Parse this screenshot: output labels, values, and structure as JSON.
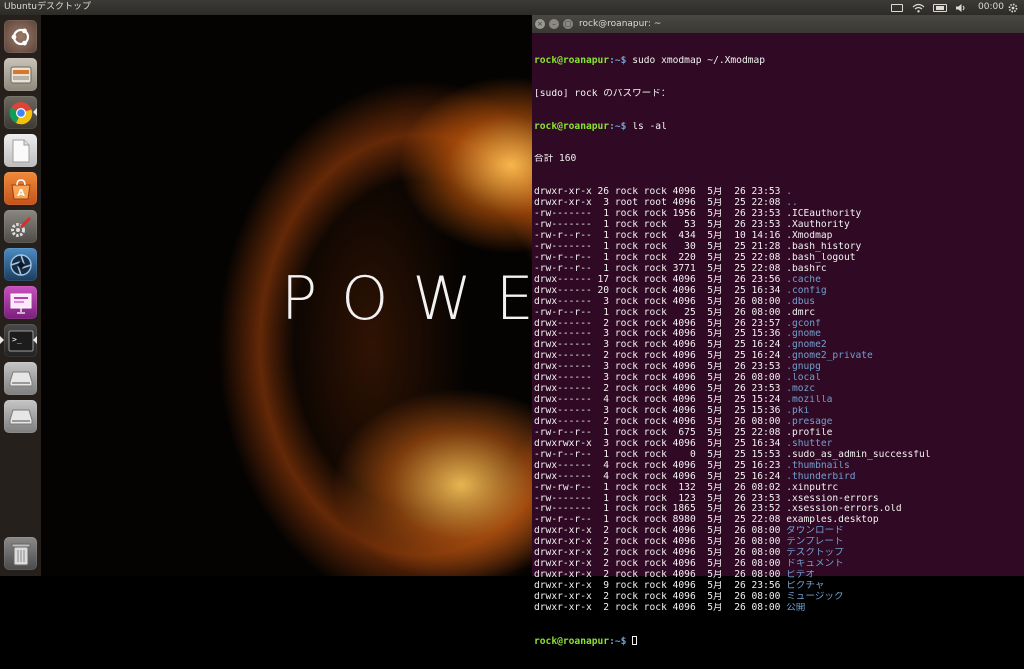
{
  "top_panel": {
    "title": "Ubuntuデスクトップ",
    "clock": "00:00",
    "indicators": [
      "keyboard-icon",
      "wifi-icon",
      "battery-icon",
      "volume-icon",
      "gear-icon"
    ]
  },
  "launcher": {
    "items": [
      {
        "name": "dash-home",
        "icon": "ubuntu-logo-icon"
      },
      {
        "name": "files",
        "icon": "file-manager-icon"
      },
      {
        "name": "chrome",
        "icon": "chrome-icon"
      },
      {
        "name": "document",
        "icon": "document-icon"
      },
      {
        "name": "software-center",
        "icon": "software-center-icon"
      },
      {
        "name": "system-settings",
        "icon": "settings-icon"
      },
      {
        "name": "shutter",
        "icon": "shutter-icon"
      },
      {
        "name": "presentation",
        "icon": "presentation-icon"
      },
      {
        "name": "terminal",
        "icon": "terminal-icon"
      },
      {
        "name": "drive-1",
        "icon": "drive-icon"
      },
      {
        "name": "drive-2",
        "icon": "drive-icon"
      },
      {
        "name": "trash",
        "icon": "trash-icon"
      }
    ],
    "app_letter": "A",
    "terminal_glyph": ">_"
  },
  "wallpaper": {
    "text": "POWER"
  },
  "terminal": {
    "title": "rock@roanapur: ~",
    "prompt_user": "rock@roanapur",
    "prompt_path": ":~$ ",
    "command1": "sudo xmodmap ~/.Xmodmap",
    "sudo_prompt": "[sudo] rock のパスワード：",
    "command2": "ls -al",
    "total": "合計 160",
    "entries": [
      {
        "meta": "drwxr-xr-x 26 rock rock 4096  5月  26 23:53 ",
        "name": ".",
        "dir": true
      },
      {
        "meta": "drwxr-xr-x  3 root root 4096  5月  25 22:08 ",
        "name": "..",
        "dir": true
      },
      {
        "meta": "-rw-------  1 rock rock 1956  5月  26 23:53 ",
        "name": ".ICEauthority",
        "dir": false
      },
      {
        "meta": "-rw-------  1 rock rock   53  5月  26 23:53 ",
        "name": ".Xauthority",
        "dir": false
      },
      {
        "meta": "-rw-r--r--  1 rock rock  434  5月  10 14:16 ",
        "name": ".Xmodmap",
        "dir": false
      },
      {
        "meta": "-rw-------  1 rock rock   30  5月  25 21:28 ",
        "name": ".bash_history",
        "dir": false
      },
      {
        "meta": "-rw-r--r--  1 rock rock  220  5月  25 22:08 ",
        "name": ".bash_logout",
        "dir": false
      },
      {
        "meta": "-rw-r--r--  1 rock rock 3771  5月  25 22:08 ",
        "name": ".bashrc",
        "dir": false
      },
      {
        "meta": "drwx------ 17 rock rock 4096  5月  26 23:56 ",
        "name": ".cache",
        "dir": true
      },
      {
        "meta": "drwx------ 20 rock rock 4096  5月  25 16:34 ",
        "name": ".config",
        "dir": true
      },
      {
        "meta": "drwx------  3 rock rock 4096  5月  26 08:00 ",
        "name": ".dbus",
        "dir": true
      },
      {
        "meta": "-rw-r--r--  1 rock rock   25  5月  26 08:00 ",
        "name": ".dmrc",
        "dir": false
      },
      {
        "meta": "drwx------  2 rock rock 4096  5月  26 23:57 ",
        "name": ".gconf",
        "dir": true
      },
      {
        "meta": "drwx------  3 rock rock 4096  5月  25 15:36 ",
        "name": ".gnome",
        "dir": true
      },
      {
        "meta": "drwx------  3 rock rock 4096  5月  25 16:24 ",
        "name": ".gnome2",
        "dir": true
      },
      {
        "meta": "drwx------  2 rock rock 4096  5月  25 16:24 ",
        "name": ".gnome2_private",
        "dir": true
      },
      {
        "meta": "drwx------  3 rock rock 4096  5月  26 23:53 ",
        "name": ".gnupg",
        "dir": true
      },
      {
        "meta": "drwx------  3 rock rock 4096  5月  26 08:00 ",
        "name": ".local",
        "dir": true
      },
      {
        "meta": "drwx------  2 rock rock 4096  5月  26 23:53 ",
        "name": ".mozc",
        "dir": true
      },
      {
        "meta": "drwx------  4 rock rock 4096  5月  25 15:24 ",
        "name": ".mozilla",
        "dir": true
      },
      {
        "meta": "drwx------  3 rock rock 4096  5月  25 15:36 ",
        "name": ".pki",
        "dir": true
      },
      {
        "meta": "drwx------  2 rock rock 4096  5月  26 08:00 ",
        "name": ".presage",
        "dir": true
      },
      {
        "meta": "-rw-r--r--  1 rock rock  675  5月  25 22:08 ",
        "name": ".profile",
        "dir": false
      },
      {
        "meta": "drwxrwxr-x  3 rock rock 4096  5月  25 16:34 ",
        "name": ".shutter",
        "dir": true
      },
      {
        "meta": "-rw-r--r--  1 rock rock    0  5月  25 15:53 ",
        "name": ".sudo_as_admin_successful",
        "dir": false
      },
      {
        "meta": "drwx------  4 rock rock 4096  5月  25 16:23 ",
        "name": ".thumbnails",
        "dir": true
      },
      {
        "meta": "drwx------  4 rock rock 4096  5月  25 16:24 ",
        "name": ".thunderbird",
        "dir": true
      },
      {
        "meta": "-rw-rw-r--  1 rock rock  132  5月  26 08:02 ",
        "name": ".xinputrc",
        "dir": false
      },
      {
        "meta": "-rw-------  1 rock rock  123  5月  26 23:53 ",
        "name": ".xsession-errors",
        "dir": false
      },
      {
        "meta": "-rw-------  1 rock rock 1865  5月  26 23:52 ",
        "name": ".xsession-errors.old",
        "dir": false
      },
      {
        "meta": "-rw-r--r--  1 rock rock 8980  5月  25 22:08 ",
        "name": "examples.desktop",
        "dir": false
      },
      {
        "meta": "drwxr-xr-x  2 rock rock 4096  5月  26 08:00 ",
        "name": "ダウンロード",
        "dir": true
      },
      {
        "meta": "drwxr-xr-x  2 rock rock 4096  5月  26 08:00 ",
        "name": "テンプレート",
        "dir": true
      },
      {
        "meta": "drwxr-xr-x  2 rock rock 4096  5月  26 08:00 ",
        "name": "デスクトップ",
        "dir": true
      },
      {
        "meta": "drwxr-xr-x  2 rock rock 4096  5月  26 08:00 ",
        "name": "ドキュメント",
        "dir": true
      },
      {
        "meta": "drwxr-xr-x  2 rock rock 4096  5月  26 08:00 ",
        "name": "ビデオ",
        "dir": true
      },
      {
        "meta": "drwxr-xr-x  9 rock rock 4096  5月  26 23:56 ",
        "name": "ピクチャ",
        "dir": true
      },
      {
        "meta": "drwxr-xr-x  2 rock rock 4096  5月  26 08:00 ",
        "name": "ミュージック",
        "dir": true
      },
      {
        "meta": "drwxr-xr-x  2 rock rock 4096  5月  26 08:00 ",
        "name": "公開",
        "dir": true
      }
    ]
  }
}
